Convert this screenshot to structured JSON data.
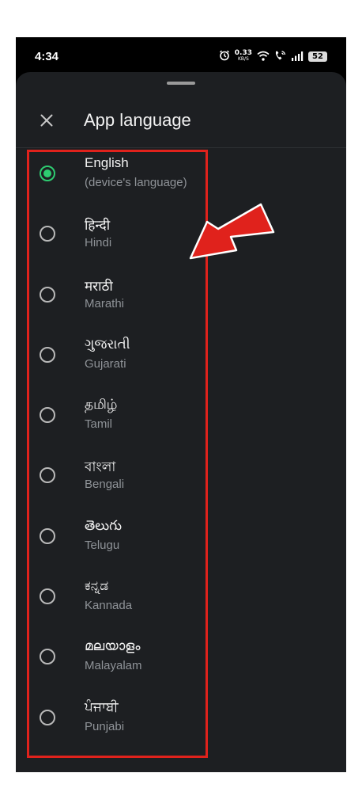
{
  "status_bar": {
    "time": "4:34",
    "net_speed_value": "0.33",
    "net_speed_unit": "KB/S",
    "battery": "52",
    "icons": [
      "alarm-icon",
      "wifi-icon",
      "wifi-calling-icon",
      "signal-icon",
      "battery-icon"
    ]
  },
  "sheet": {
    "title": "App language",
    "close_icon": "close-icon"
  },
  "languages": [
    {
      "native": "English",
      "sub": "(device's language)",
      "selected": true
    },
    {
      "native": "हिन्दी",
      "sub": "Hindi",
      "selected": false
    },
    {
      "native": "मराठी",
      "sub": "Marathi",
      "selected": false
    },
    {
      "native": "ગુજરાતી",
      "sub": "Gujarati",
      "selected": false
    },
    {
      "native": "தமிழ்",
      "sub": "Tamil",
      "selected": false
    },
    {
      "native": "বাংলা",
      "sub": "Bengali",
      "selected": false
    },
    {
      "native": "తెలుగు",
      "sub": "Telugu",
      "selected": false
    },
    {
      "native": "ಕನ್ನಡ",
      "sub": "Kannada",
      "selected": false
    },
    {
      "native": "മലയാളം",
      "sub": "Malayalam",
      "selected": false
    },
    {
      "native": "ਪੰਜਾਬੀ",
      "sub": "Punjabi",
      "selected": false
    }
  ],
  "colors": {
    "sheet_background": "#1d1f22",
    "selected_radio": "#2ecc71",
    "highlight": "#e0221c"
  }
}
